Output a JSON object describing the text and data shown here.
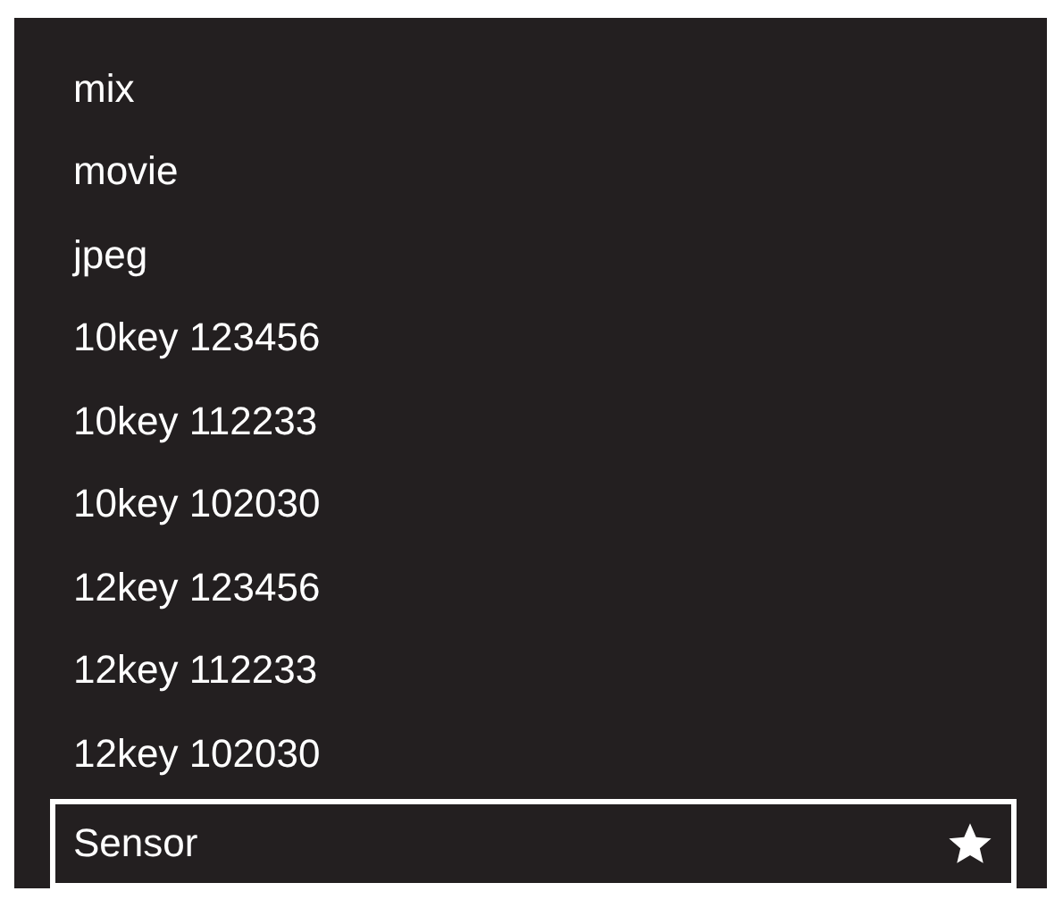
{
  "items": [
    {
      "label": "mix",
      "selected": false,
      "favorite": false
    },
    {
      "label": "movie",
      "selected": false,
      "favorite": false
    },
    {
      "label": "jpeg",
      "selected": false,
      "favorite": false
    },
    {
      "label": "10key 123456",
      "selected": false,
      "favorite": false
    },
    {
      "label": "10key 112233",
      "selected": false,
      "favorite": false
    },
    {
      "label": "10key 102030",
      "selected": false,
      "favorite": false
    },
    {
      "label": "12key 123456",
      "selected": false,
      "favorite": false
    },
    {
      "label": "12key 112233",
      "selected": false,
      "favorite": false
    },
    {
      "label": "12key 102030",
      "selected": false,
      "favorite": false
    },
    {
      "label": "Sensor",
      "selected": true,
      "favorite": true
    }
  ]
}
